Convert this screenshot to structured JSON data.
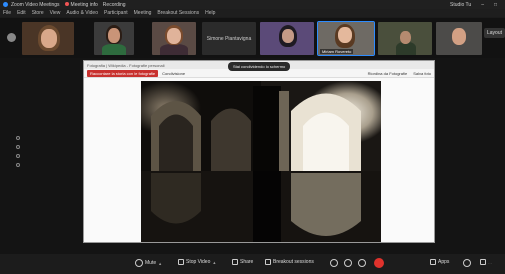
{
  "titlebar": {
    "app": "Zoom Video Meetings",
    "meeting": "Meeting info",
    "rec": "Recording",
    "right_time": "Studio Tu"
  },
  "menu": [
    "File",
    "Edit",
    "Store",
    "View",
    "Audio & Video",
    "Participant",
    "Meeting",
    "Breakout Sessions",
    "Help"
  ],
  "participants": {
    "center_name": "Simone Piantavigna",
    "active_name": "Miriam Rovereto",
    "layout": "Layout"
  },
  "share": {
    "topbar": "Fotografia | Wikipedia - Fotografie personali",
    "left_btn": "Raccontare la storia con le fotografie",
    "center_item": "Condivisione",
    "pill": "Stai condividendo lo schermo",
    "right_items": [
      "Riordina da Fotografie",
      "Salva foto"
    ]
  },
  "bottombar": {
    "mute": "Mute",
    "video": "Stop Video",
    "share": "Share",
    "breakout": "Breakout sessions",
    "apps": "Apps"
  },
  "colors": {
    "accent": "#2d8cff",
    "end": "#e0322c"
  }
}
